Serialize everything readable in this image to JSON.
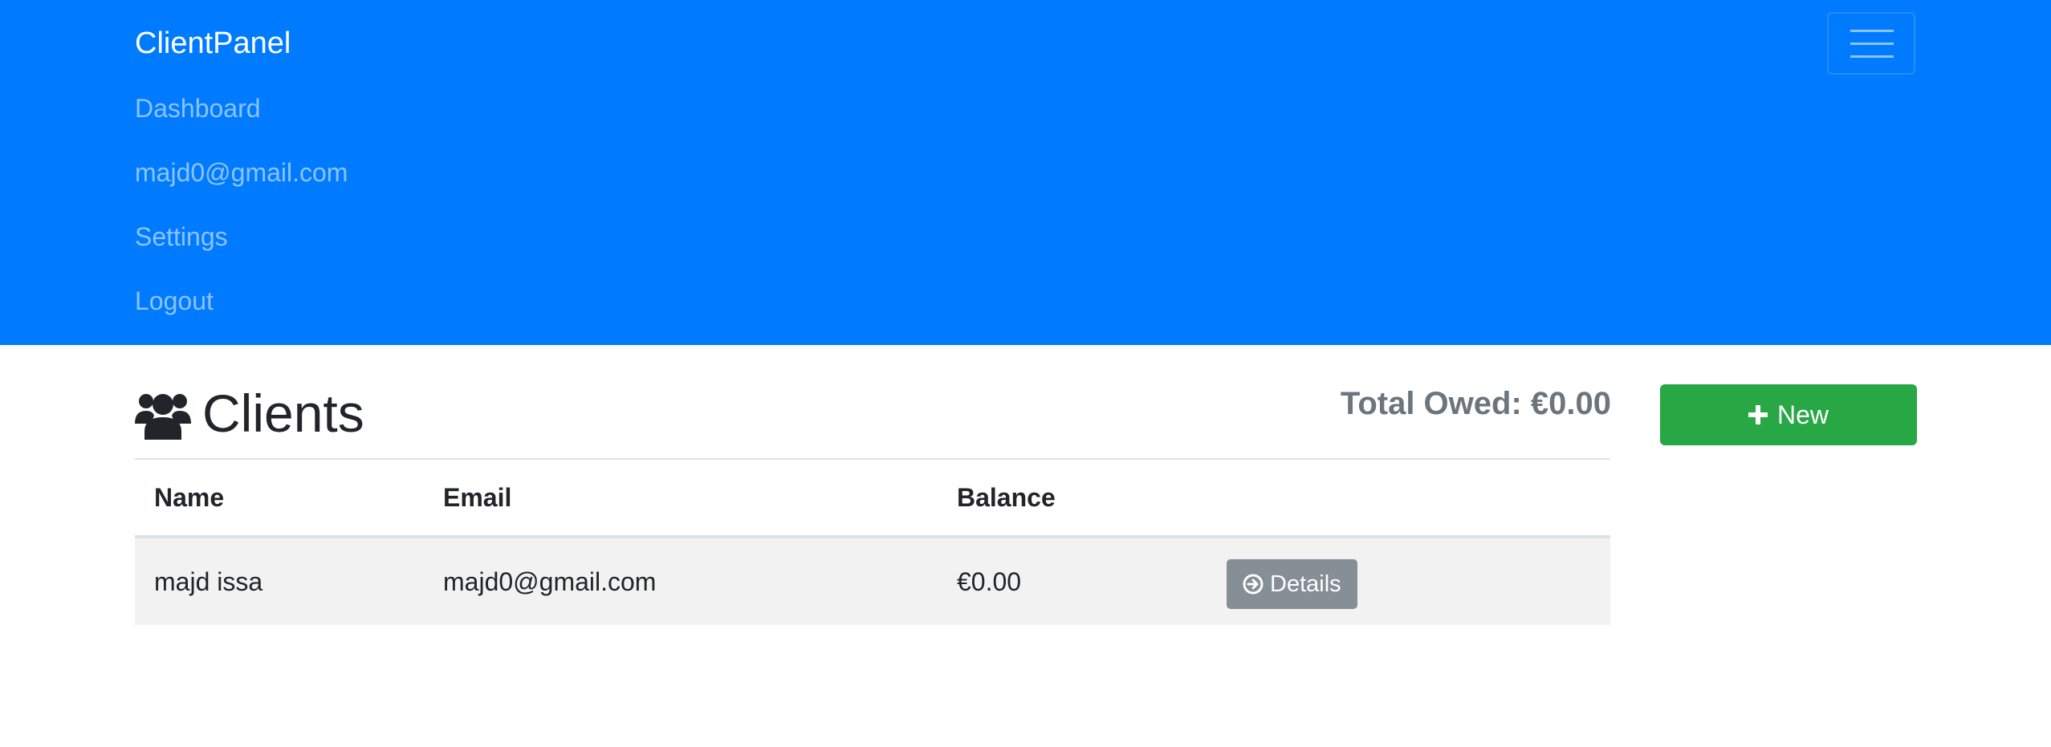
{
  "navbar": {
    "brand": "ClientPanel",
    "links": [
      "Dashboard",
      "majd0@gmail.com",
      "Settings",
      "Logout"
    ]
  },
  "page": {
    "title": "Clients",
    "title_icon": "users-icon",
    "total_owed": "Total Owed: €0.00",
    "new_button_label": "New",
    "new_button_icon": "plus-icon"
  },
  "table": {
    "headers": [
      "Name",
      "Email",
      "Balance",
      ""
    ],
    "rows": [
      {
        "name": "majd issa",
        "email": "majd0@gmail.com",
        "balance": "€0.00",
        "action_label": "Details",
        "action_icon": "arrow-circle-right-icon"
      }
    ]
  },
  "colors": {
    "navbar": "#007bff",
    "success": "#28a745",
    "secondary": "#868e96",
    "muted": "#6c757d",
    "row_stripe": "#f2f2f2"
  }
}
